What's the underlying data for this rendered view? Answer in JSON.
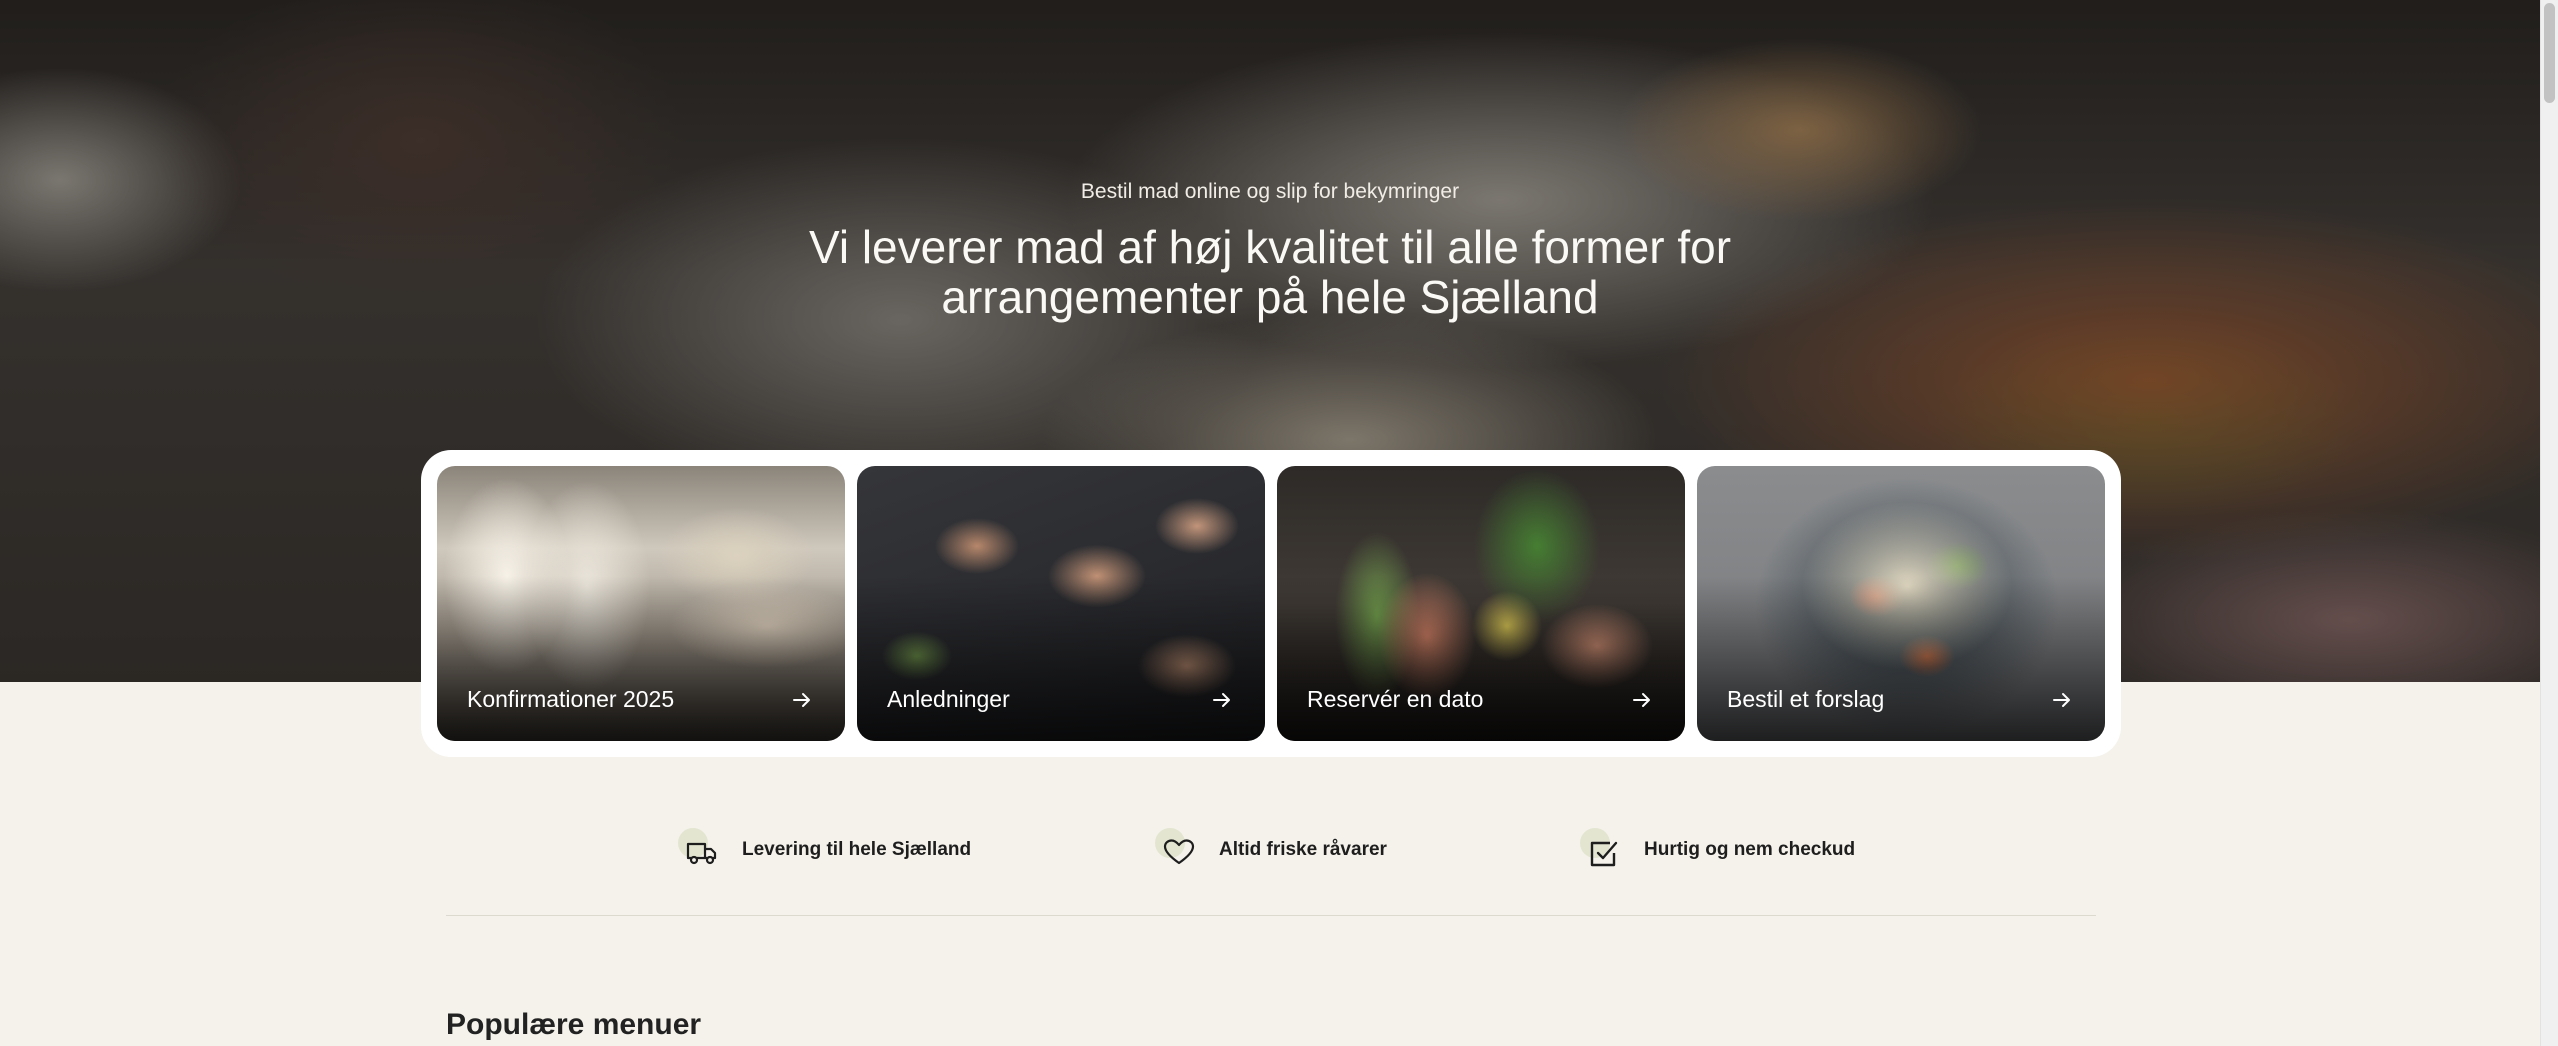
{
  "hero": {
    "eyebrow": "Bestil mad online og slip for bekymringer",
    "title": "Vi leverer mad af høj kvalitet til alle former for arrangementer på hele Sjælland"
  },
  "cards": [
    {
      "label": "Konfirmationer 2025",
      "icon": "arrow-right-icon"
    },
    {
      "label": "Anledninger",
      "icon": "arrow-right-icon"
    },
    {
      "label": "Reservér en dato",
      "icon": "arrow-right-icon"
    },
    {
      "label": "Bestil et forslag",
      "icon": "arrow-right-icon"
    }
  ],
  "features": [
    {
      "label": "Levering til hele Sjælland",
      "icon": "truck-icon"
    },
    {
      "label": "Altid friske råvarer",
      "icon": "heart-icon"
    },
    {
      "label": "Hurtig og nem checkud",
      "icon": "checkbox-icon"
    }
  ],
  "section": {
    "title": "Populære menuer"
  },
  "colors": {
    "background": "#f4f2ea",
    "card_container": "#ffffff",
    "feature_blob": "#e3e5d0",
    "text_dark": "#1e1e1e"
  }
}
